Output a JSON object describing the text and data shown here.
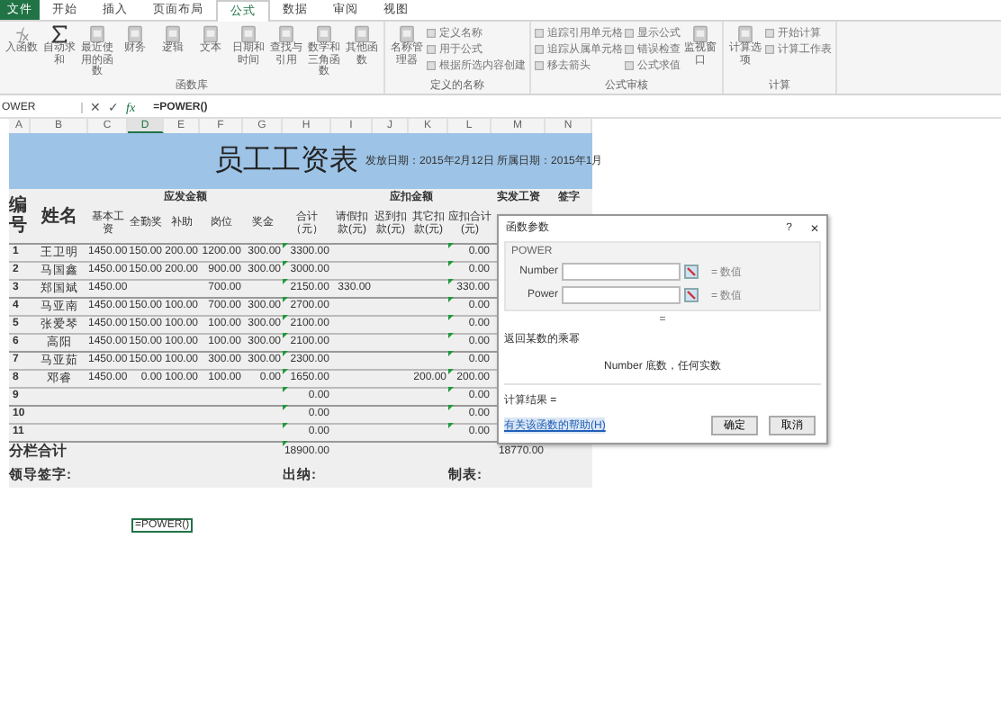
{
  "ribbon": {
    "tabs": [
      {
        "label": "文件",
        "kind": "file",
        "selected": false
      },
      {
        "label": "开始",
        "kind": "tab",
        "selected": false
      },
      {
        "label": "插入",
        "kind": "tab",
        "selected": false
      },
      {
        "label": "页面布局",
        "kind": "tab",
        "selected": false
      },
      {
        "label": "公式",
        "kind": "tab",
        "selected": true
      },
      {
        "label": "数据",
        "kind": "tab",
        "selected": false
      },
      {
        "label": "审阅",
        "kind": "tab",
        "selected": false
      },
      {
        "label": "视图",
        "kind": "tab",
        "selected": false
      }
    ],
    "groups": [
      {
        "label": "函数库",
        "items": [
          {
            "kind": "large",
            "label": "入函数"
          },
          {
            "kind": "large",
            "label": "自动求和"
          },
          {
            "kind": "large",
            "label": "最近使用的函数"
          },
          {
            "kind": "large",
            "label": "财务"
          },
          {
            "kind": "large",
            "label": "逻辑"
          },
          {
            "kind": "large",
            "label": "文本"
          },
          {
            "kind": "large",
            "label": "日期和时间"
          },
          {
            "kind": "large",
            "label": "查找与引用"
          },
          {
            "kind": "large",
            "label": "数学和三角函数"
          },
          {
            "kind": "large",
            "label": "其他函数"
          }
        ]
      },
      {
        "label": "定义的名称",
        "items": [
          {
            "kind": "large",
            "label": "名称管理器"
          },
          {
            "kind": "stack",
            "buttons": [
              {
                "label": "定义名称"
              },
              {
                "label": "用于公式"
              },
              {
                "label": "根据所选内容创建"
              }
            ]
          }
        ]
      },
      {
        "label": "公式审核",
        "items": [
          {
            "kind": "stack",
            "buttons": [
              {
                "label": "追踪引用单元格"
              },
              {
                "label": "追踪从属单元格"
              },
              {
                "label": "移去箭头"
              }
            ]
          },
          {
            "kind": "stack",
            "buttons": [
              {
                "label": "显示公式"
              },
              {
                "label": "错误检查"
              },
              {
                "label": "公式求值"
              }
            ]
          },
          {
            "kind": "large",
            "label": "监视窗口"
          }
        ]
      },
      {
        "label": "计算",
        "items": [
          {
            "kind": "large",
            "label": "计算选项"
          },
          {
            "kind": "stack",
            "buttons": [
              {
                "label": "开始计算"
              },
              {
                "label": "计算工作表"
              }
            ]
          }
        ]
      }
    ]
  },
  "formula_bar": {
    "name_box": "OWER",
    "cancel": "✕",
    "enter": "✓",
    "fx": "fx",
    "formula": "=POWER()"
  },
  "sheet": {
    "columns": [
      {
        "letter": "A",
        "selected": false
      },
      {
        "letter": "B",
        "selected": false
      },
      {
        "letter": "C",
        "selected": false
      },
      {
        "letter": "D",
        "selected": true
      },
      {
        "letter": "E",
        "selected": false
      },
      {
        "letter": "F",
        "selected": false
      },
      {
        "letter": "G",
        "selected": false
      },
      {
        "letter": "H",
        "selected": false
      },
      {
        "letter": "I",
        "selected": false
      },
      {
        "letter": "J",
        "selected": false
      },
      {
        "letter": "K",
        "selected": false
      },
      {
        "letter": "L",
        "selected": false
      },
      {
        "letter": "M",
        "selected": false
      },
      {
        "letter": "N",
        "selected": false
      }
    ],
    "title": "员工工资表",
    "date_line": "发放日期：2015年2月12日 所属日期：2015年1月",
    "number_header": "编号",
    "name_header": "姓名",
    "group_headers": [
      "应发金额",
      "应扣金额",
      "实发工资",
      "签字"
    ],
    "sub_headers": [
      "基本工资",
      "全勤奖",
      "补助",
      "岗位",
      "奖金",
      "合计（元）",
      "请假扣款(元)",
      "迟到扣款(元)",
      "其它扣款(元)",
      "应扣合计(元)"
    ],
    "rows": [
      {
        "no": "1",
        "name": "王卫明",
        "base_pay": "1450.00",
        "attendance_bonus": "150.00",
        "allowance": "200.00",
        "post": "1200.00",
        "bonus": "300.00",
        "total": "3300.00",
        "deduction_total": "0.00",
        "flagged": true
      },
      {
        "no": "2",
        "name": "马国鑫",
        "base_pay": "1450.00",
        "attendance_bonus": "150.00",
        "allowance": "200.00",
        "post": "900.00",
        "bonus": "300.00",
        "total": "3000.00",
        "deduction_total": "0.00",
        "flagged": true
      },
      {
        "no": "3",
        "name": "郑国斌",
        "base_pay": "1450.00",
        "post": "700.00",
        "total": "2150.00",
        "leave_deduction": "330.00",
        "deduction_total": "330.00",
        "flagged": true
      },
      {
        "no": "4",
        "name": "马亚南",
        "base_pay": "1450.00",
        "attendance_bonus": "150.00",
        "allowance": "100.00",
        "post": "700.00",
        "bonus": "300.00",
        "total": "2700.00",
        "deduction_total": "0.00",
        "flagged": true
      },
      {
        "no": "5",
        "name": "张爱琴",
        "base_pay": "1450.00",
        "attendance_bonus": "150.00",
        "allowance": "100.00",
        "post": "100.00",
        "bonus": "300.00",
        "total": "2100.00",
        "deduction_total": "0.00",
        "flagged": true
      },
      {
        "no": "6",
        "name": "高阳",
        "base_pay": "1450.00",
        "attendance_bonus": "150.00",
        "allowance": "100.00",
        "post": "100.00",
        "bonus": "300.00",
        "total": "2100.00",
        "deduction_total": "0.00",
        "flagged": true
      },
      {
        "no": "7",
        "name": "马亚茹",
        "base_pay": "1450.00",
        "attendance_bonus": "150.00",
        "allowance": "100.00",
        "post": "300.00",
        "bonus": "300.00",
        "total": "2300.00",
        "deduction_total": "0.00",
        "flagged": true
      },
      {
        "no": "8",
        "name": "邓睿",
        "base_pay": "1450.00",
        "attendance_bonus": "0.00",
        "allowance": "100.00",
        "post": "100.00",
        "bonus": "0.00",
        "total": "1650.00",
        "other_deduction": "200.00",
        "deduction_total": "200.00",
        "flagged": true
      },
      {
        "no": "9",
        "total": "0.00",
        "deduction_total": "0.00",
        "flagged": true
      },
      {
        "no": "10",
        "total": "0.00",
        "deduction_total": "0.00",
        "flagged": true
      },
      {
        "no": "11",
        "total": "0.00",
        "deduction_total": "0.00",
        "flagged": true
      }
    ],
    "summary": {
      "label": "分栏合计",
      "total": "18900.00",
      "net_pay": "18770.00",
      "flagged": true
    },
    "signatures": [
      "领导签字:",
      "出纳:",
      "制表:"
    ],
    "active_cell": "=POWER()"
  },
  "dialog": {
    "title": "函数参数",
    "help": "?",
    "close": "✕",
    "function": "POWER",
    "args": [
      {
        "label": "Number",
        "result": "= 数值"
      },
      {
        "label": "Power",
        "result": "= 数值"
      }
    ],
    "equals": "=",
    "description": "返回某数的乘幂",
    "arg_help": "Number  底数，任何实数",
    "result_label": "计算结果 =",
    "help_link": "有关该函数的帮助(H)",
    "buttons": [
      "确定",
      "取消"
    ]
  }
}
